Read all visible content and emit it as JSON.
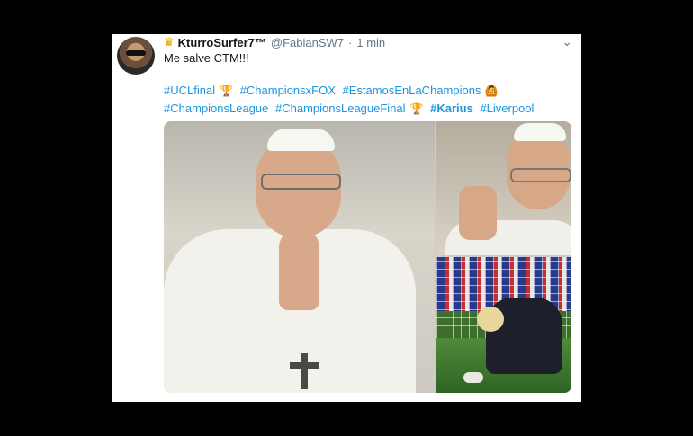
{
  "tweet": {
    "display_name": "KturroSurfer7™",
    "handle": "@FabianSW7",
    "separator": "·",
    "time": "1 min",
    "text": "Me salve CTM!!!",
    "hashtags": [
      {
        "text": "#UCLfinal",
        "bold": false
      },
      {
        "text": "#ChampionsxFOX",
        "bold": false
      },
      {
        "text": "#EstamosEnLaChampions",
        "bold": false
      },
      {
        "text": "#ChampionsLeague",
        "bold": false
      },
      {
        "text": "#ChampionsLeagueFinal",
        "bold": false
      },
      {
        "text": "#Karius",
        "bold": true
      },
      {
        "text": "#Liverpool",
        "bold": false
      }
    ]
  },
  "icons": {
    "badge": "crown-icon",
    "menu": "chevron-down-icon",
    "trophy": "trophy-emoji",
    "man": "man-emoji"
  },
  "colors": {
    "link": "#1b95e0",
    "text": "#14171a",
    "muted": "#657786",
    "background": "#000000",
    "card": "#ffffff"
  }
}
